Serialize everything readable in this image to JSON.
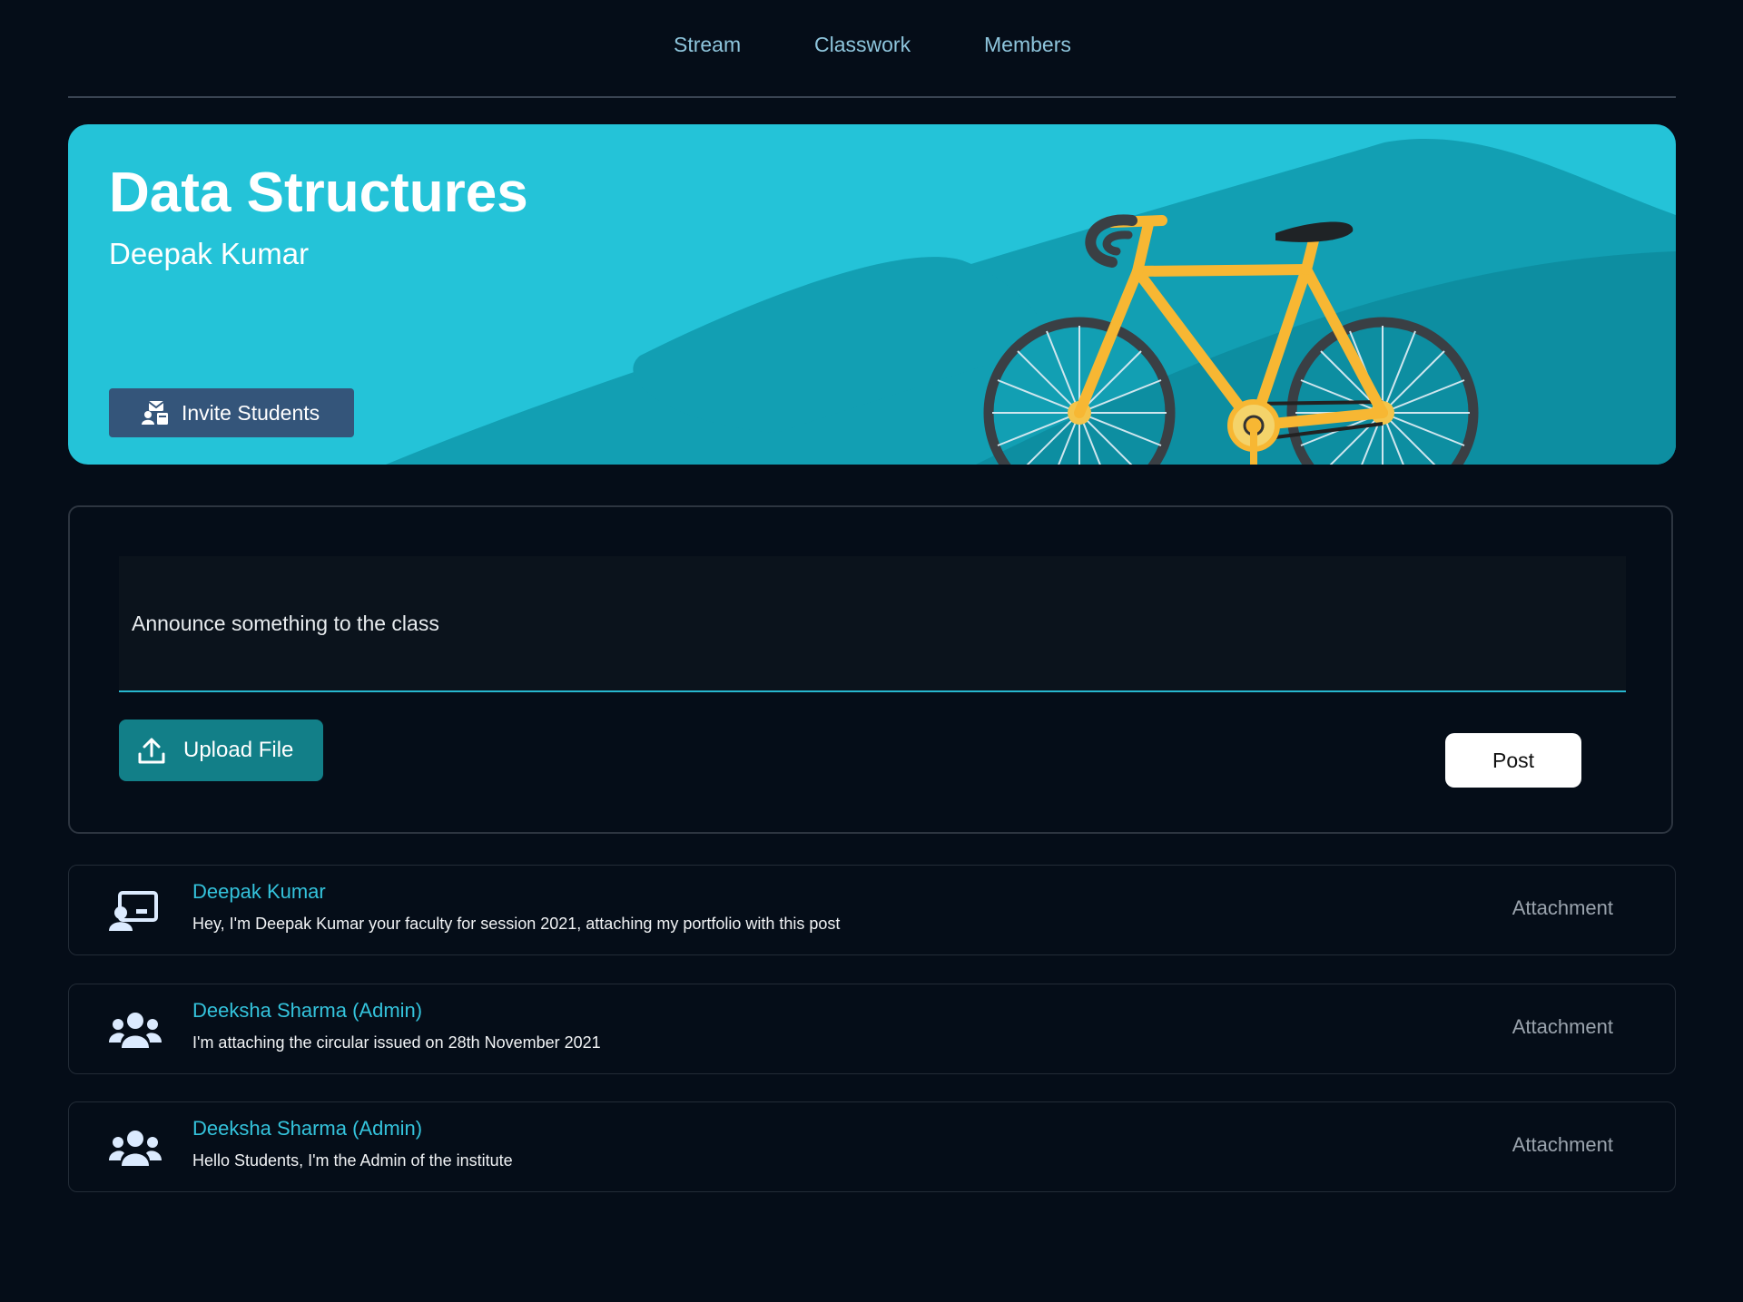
{
  "nav": {
    "tabs": [
      {
        "label": "Stream"
      },
      {
        "label": "Classwork"
      },
      {
        "label": "Members"
      }
    ]
  },
  "banner": {
    "title": "Data Structures",
    "teacher": "Deepak Kumar",
    "invite_button": "Invite Students",
    "illustration": "bicycle-illustration",
    "colors": {
      "background": "#24c3d8",
      "hill": "#0e97ab",
      "bike_frame": "#f7b733"
    }
  },
  "composer": {
    "placeholder": "Announce something to the class",
    "upload_button": "Upload File",
    "post_button": "Post"
  },
  "feed": [
    {
      "icon": "teacher-icon",
      "author": "Deepak Kumar",
      "message": "Hey, I'm Deepak Kumar your faculty for session 2021, attaching my portfolio with this post",
      "attachment": "Attachment"
    },
    {
      "icon": "users-icon",
      "author": "Deeksha Sharma (Admin)",
      "message": "I'm attaching the circular issued on 28th November 2021",
      "attachment": "Attachment"
    },
    {
      "icon": "users-icon",
      "author": "Deeksha Sharma (Admin)",
      "message": "Hello Students, I'm the Admin of the institute",
      "attachment": "Attachment"
    }
  ],
  "theme": {
    "page_background": "#050d18",
    "accent": "#34c3dc",
    "nav_text": "#8ec5dc",
    "invite_button": "#34557a",
    "upload_button": "#127f88"
  }
}
